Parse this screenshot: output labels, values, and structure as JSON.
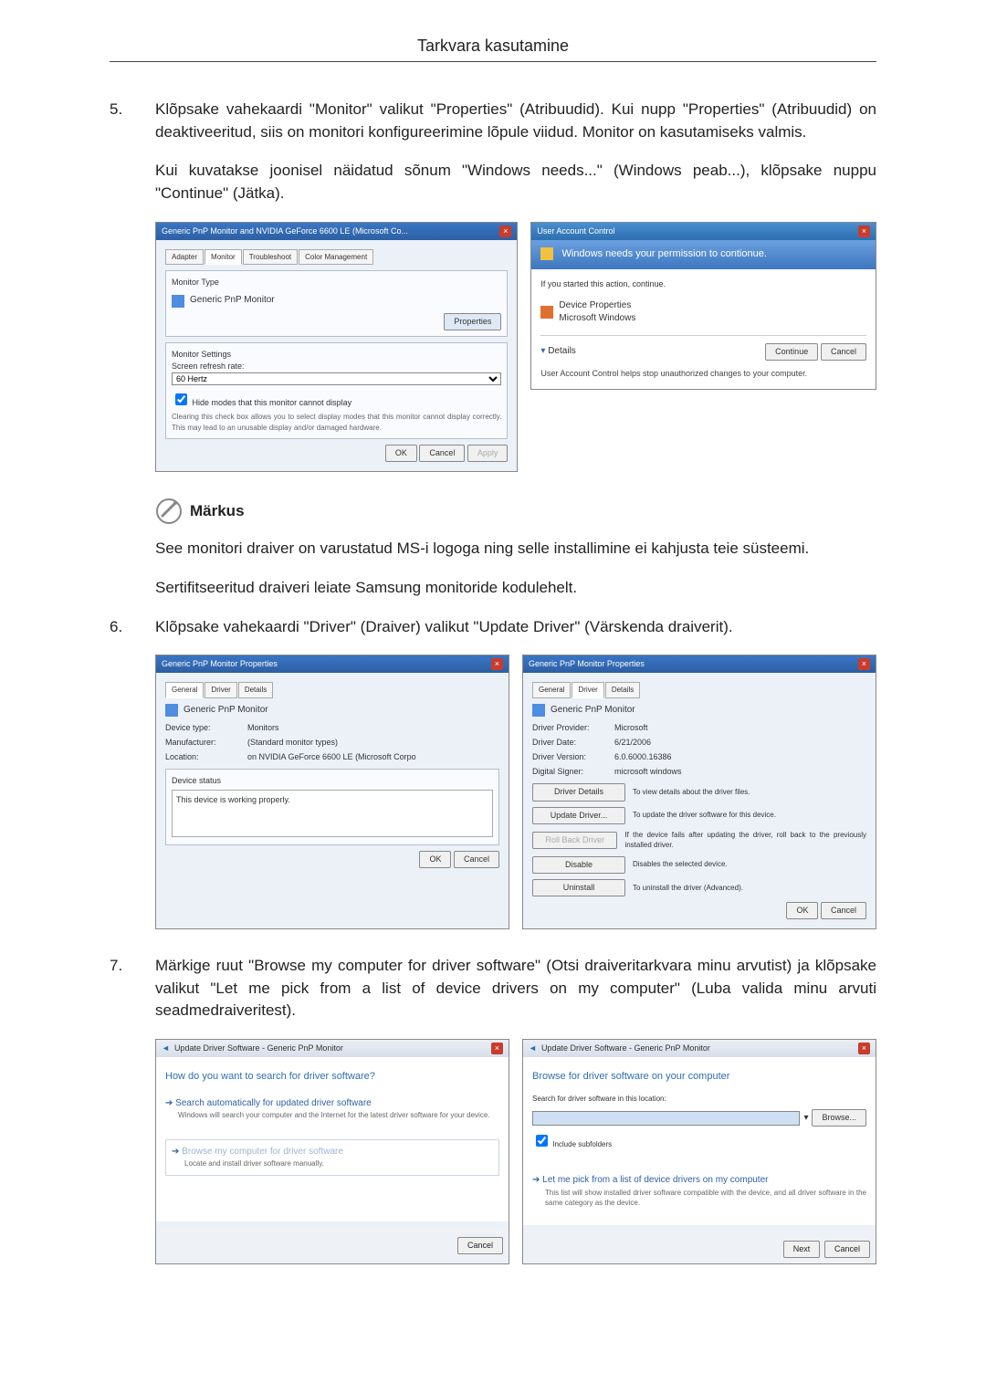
{
  "header": {
    "title": "Tarkvara kasutamine"
  },
  "step5": {
    "p1": "Klõpsake vahekaardi \"Monitor\" valikut \"Properties\" (Atribuudid). Kui nupp \"Properties\" (Atribuudid) on deaktiveeritud, siis on monitori konfigureerimine lõpule viidud. Monitor on kasutamiseks valmis.",
    "p2": "Kui kuvatakse joonisel näidatud sõnum \"Windows needs...\" (Windows peab...), klõpsake nuppu \"Continue\" (Jätka).",
    "figA": {
      "title": "Generic PnP Monitor and NVIDIA GeForce 6600 LE (Microsoft Co...",
      "tabs": [
        "Adapter",
        "Monitor",
        "Troubleshoot",
        "Color Management"
      ],
      "grp1_label": "Monitor Type",
      "monitor_name": "Generic PnP Monitor",
      "properties_btn": "Properties",
      "grp2_label": "Monitor Settings",
      "refresh_label": "Screen refresh rate:",
      "refresh_value": "60 Hertz",
      "hide_label": "Hide modes that this monitor cannot display",
      "hide_note": "Clearing this check box allows you to select display modes that this monitor cannot display correctly. This may lead to an unusable display and/or damaged hardware.",
      "ok": "OK",
      "cancel": "Cancel",
      "apply": "Apply"
    },
    "figB": {
      "title": "User Account Control",
      "band": "Windows needs your permission to contionue.",
      "started": "If you started this action, continue.",
      "devprop": "Device Properties",
      "mswin": "Microsoft Windows",
      "details": "Details",
      "continue": "Continue",
      "cancel": "Cancel",
      "footer": "User Account Control helps stop unauthorized changes to your computer."
    }
  },
  "note": {
    "label": "Märkus",
    "p1": "See monitori draiver on varustatud MS-i logoga ning selle installimine ei kahjusta teie süsteemi.",
    "p2": "Sertifitseeritud draiveri leiate Samsung monitoride kodulehelt."
  },
  "step6": {
    "p1": "Klõpsake vahekaardi \"Driver\" (Draiver) valikut \"Update Driver\" (Värskenda draiverit).",
    "figA": {
      "title": "Generic PnP Monitor Properties",
      "tabs": [
        "General",
        "Driver",
        "Details"
      ],
      "monitor_name": "Generic PnP Monitor",
      "devtype_k": "Device type:",
      "devtype_v": "Monitors",
      "manu_k": "Manufacturer:",
      "manu_v": "(Standard monitor types)",
      "loc_k": "Location:",
      "loc_v": "on NVIDIA GeForce 6600 LE (Microsoft Corpo",
      "status_label": "Device status",
      "status_text": "This device is working properly.",
      "ok": "OK",
      "cancel": "Cancel"
    },
    "figB": {
      "title": "Generic PnP Monitor Properties",
      "tabs": [
        "General",
        "Driver",
        "Details"
      ],
      "monitor_name": "Generic PnP Monitor",
      "prov_k": "Driver Provider:",
      "prov_v": "Microsoft",
      "date_k": "Driver Date:",
      "date_v": "6/21/2006",
      "ver_k": "Driver Version:",
      "ver_v": "6.0.6000.16386",
      "sig_k": "Digital Signer:",
      "sig_v": "microsoft windows",
      "b1": "Driver Details",
      "b1d": "To view details about the driver files.",
      "b2": "Update Driver...",
      "b2d": "To update the driver software for this device.",
      "b3": "Roll Back Driver",
      "b3d": "If the device fails after updating the driver, roll back to the previously installed driver.",
      "b4": "Disable",
      "b4d": "Disables the selected device.",
      "b5": "Uninstall",
      "b5d": "To uninstall the driver (Advanced).",
      "ok": "OK",
      "cancel": "Cancel"
    }
  },
  "step7": {
    "p1": "Märkige ruut \"Browse my computer for driver software\" (Otsi draiveritarkvara minu arvutist) ja klõpsake valikut \"Let me pick from a list of device drivers on my computer\" (Luba valida minu arvuti seadmedraiveritest).",
    "figA": {
      "crumb": "Update Driver Software - Generic PnP Monitor",
      "q": "How do you want to search for driver software?",
      "opt1_t": "Search automatically for updated driver software",
      "opt1_d": "Windows will search your computer and the Internet for the latest driver software for your device.",
      "opt2_t": "Browse my computer for driver software",
      "opt2_d": "Locate and install driver software manually.",
      "cancel": "Cancel"
    },
    "figB": {
      "crumb": "Update Driver Software - Generic PnP Monitor",
      "h": "Browse for driver software on your computer",
      "loc_label": "Search for driver software in this location:",
      "browse": "Browse...",
      "include": "Include subfolders",
      "pick_t": "Let me pick from a list of device drivers on my computer",
      "pick_d": "This list will show installed driver software compatible with the device, and all driver software in the same category as the device.",
      "next": "Next",
      "cancel": "Cancel"
    }
  }
}
